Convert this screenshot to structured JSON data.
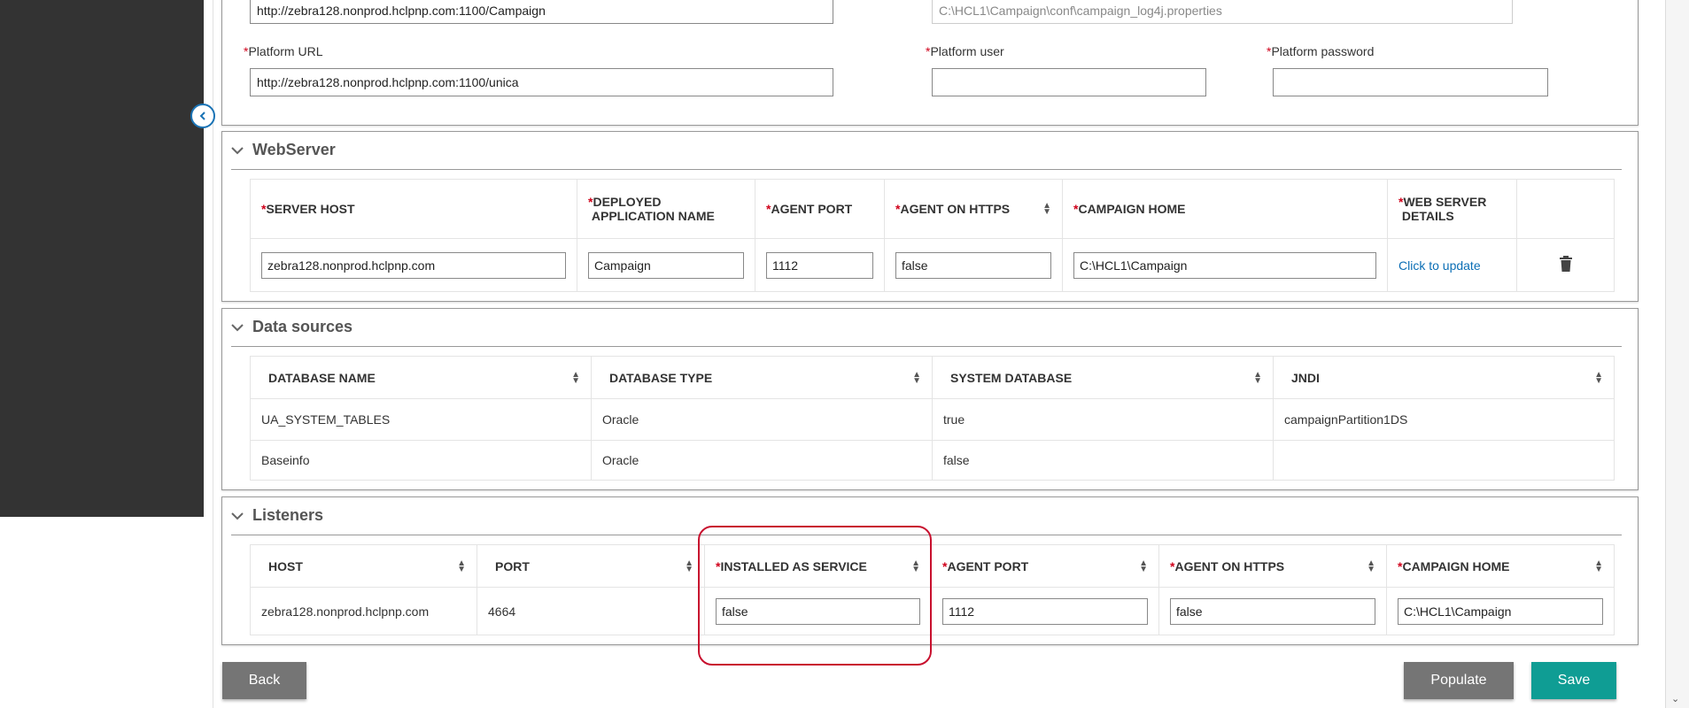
{
  "top_form": {
    "campaign_url_value": "http://zebra128.nonprod.hclpnp.com:1100/Campaign",
    "log4j_path_value": "C:\\HCL1\\Campaign\\conf\\campaign_log4j.properties",
    "platform_url_label": "Platform URL",
    "platform_url_value": "http://zebra128.nonprod.hclpnp.com:1100/unica",
    "platform_user_label": "Platform user",
    "platform_user_value": "",
    "platform_password_label": "Platform password",
    "platform_password_value": "",
    "required_mark": "*"
  },
  "webserver": {
    "title": "WebServer",
    "headers": {
      "server_host": "SERVER HOST",
      "deployed_app_name_1": "DEPLOYED",
      "deployed_app_name_2": "APPLICATION NAME",
      "agent_port": "AGENT PORT",
      "agent_on_https": "AGENT ON HTTPS",
      "campaign_home": "CAMPAIGN HOME",
      "web_server_details_1": "WEB SERVER",
      "web_server_details_2": "DETAILS"
    },
    "row": {
      "server_host": "zebra128.nonprod.hclpnp.com",
      "deployed_app_name": "Campaign",
      "agent_port": "1112",
      "agent_on_https": "false",
      "campaign_home": "C:\\HCL1\\Campaign",
      "details_link": "Click to update"
    }
  },
  "data_sources": {
    "title": "Data sources",
    "headers": [
      "DATABASE NAME",
      "DATABASE TYPE",
      "SYSTEM DATABASE",
      "JNDI"
    ],
    "rows": [
      [
        "UA_SYSTEM_TABLES",
        "Oracle",
        "true",
        "campaignPartition1DS"
      ],
      [
        "Baseinfo",
        "Oracle",
        "false",
        ""
      ]
    ]
  },
  "listeners": {
    "title": "Listeners",
    "headers": {
      "host": "HOST",
      "port": "PORT",
      "installed_as_service": "INSTALLED AS SERVICE",
      "agent_port": "AGENT PORT",
      "agent_on_https": "AGENT ON HTTPS",
      "campaign_home": "CAMPAIGN HOME"
    },
    "row": {
      "host": "zebra128.nonprod.hclpnp.com",
      "port": "4664",
      "installed_as_service": "false",
      "agent_port": "1112",
      "agent_on_https": "false",
      "campaign_home": "C:\\HCL1\\Campaign"
    }
  },
  "buttons": {
    "back": "Back",
    "populate": "Populate",
    "save": "Save"
  },
  "colors": {
    "required": "#d0021b",
    "link": "#0b6eb5",
    "save_button": "#0f9d94",
    "gray_button": "#757575",
    "highlight": "#c8102e",
    "sidebar": "#333333"
  }
}
